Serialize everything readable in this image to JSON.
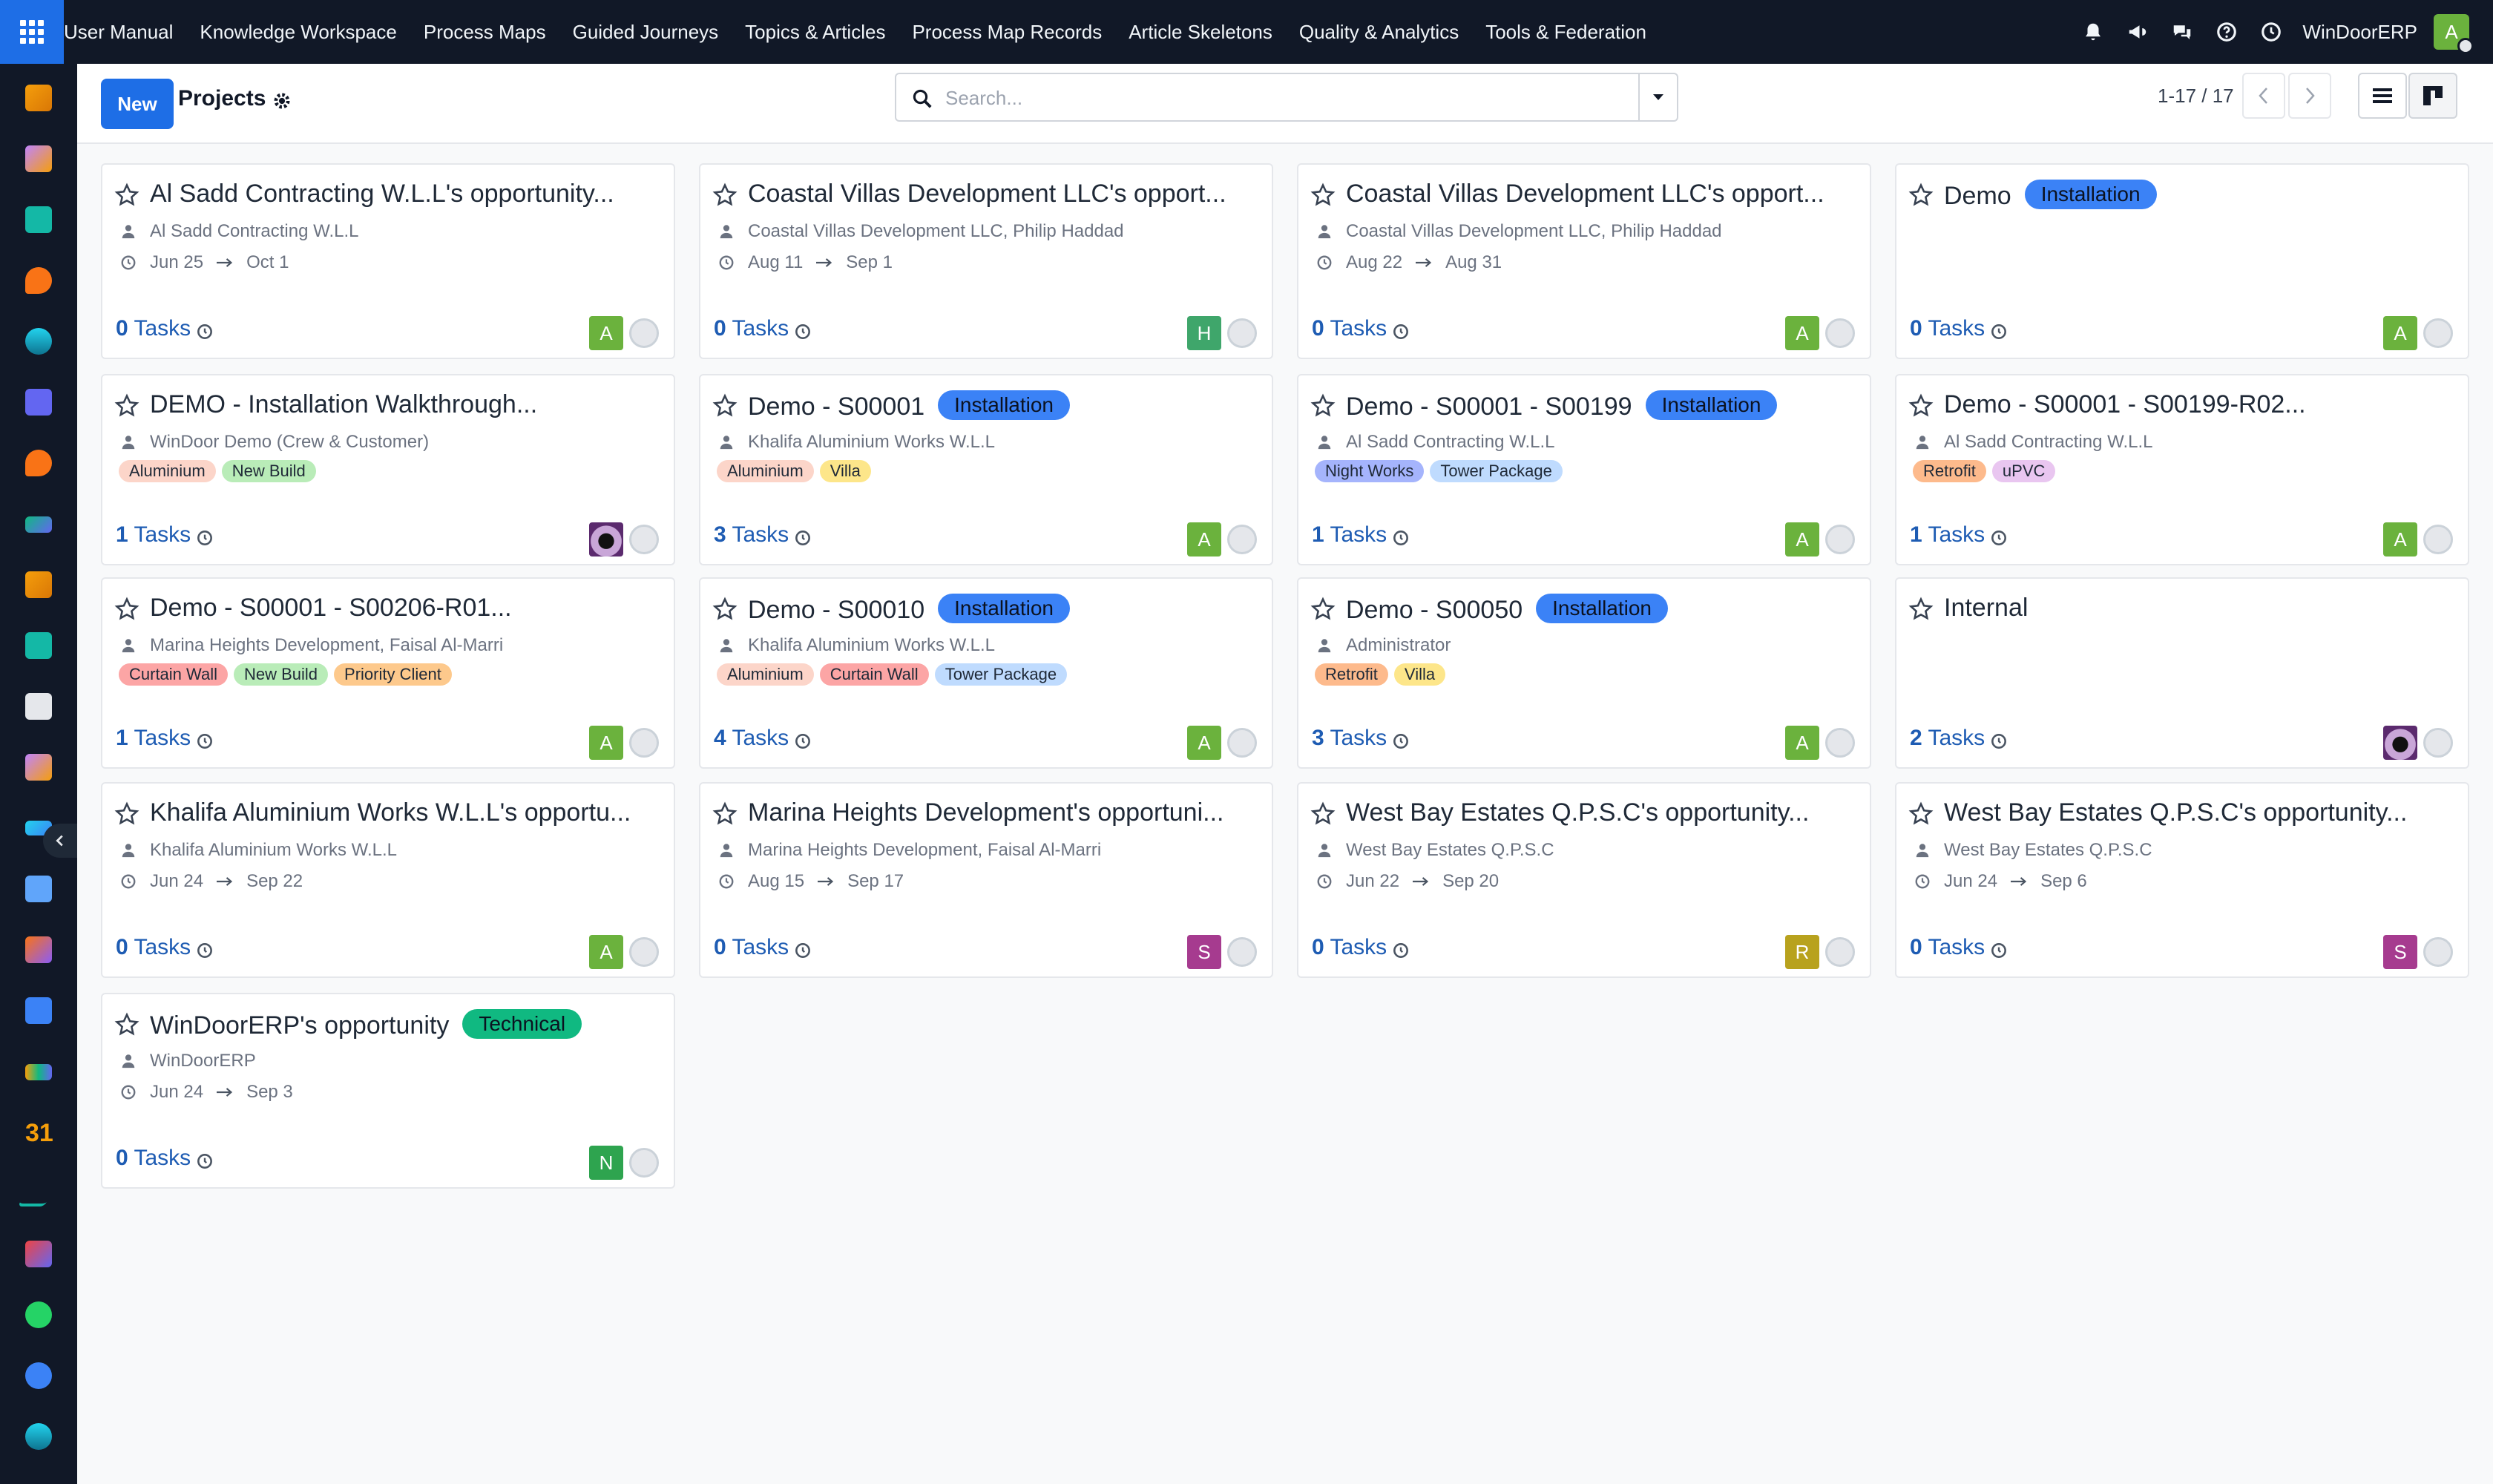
{
  "topbar": {
    "menu": [
      "User Manual",
      "Knowledge Workspace",
      "Process Maps",
      "Guided Journeys",
      "Topics & Articles",
      "Process Map Records",
      "Article Skeletons",
      "Quality & Analytics",
      "Tools & Federation"
    ],
    "company": "WinDoorERP",
    "user_initial": "A",
    "icons": [
      "bell-icon",
      "megaphone-icon",
      "chat-icon",
      "help-icon",
      "clock-icon"
    ]
  },
  "sidebar": {
    "icons": [
      "sales-app-icon",
      "crm-app-icon",
      "contacts-app-icon",
      "discuss-app-icon",
      "knowledge-app-icon",
      "mail-app-icon",
      "livechat-app-icon",
      "project-app-icon",
      "reports-app-icon",
      "employees-app-icon",
      "inventory-app-icon",
      "quality-app-icon",
      "todo-app-icon",
      "documents-app-icon",
      "packages-app-icon",
      "accounting-app-icon",
      "hr-app-icon",
      "calendar-app-icon",
      "sign-app-icon",
      "dashboards-app-icon",
      "whatsapp-app-icon",
      "timesheet-app-icon",
      "discuss2-app-icon"
    ],
    "calendar_label": "31"
  },
  "control": {
    "new_label": "New",
    "title": "Projects",
    "search_placeholder": "Search...",
    "pager": "1-17 / 17"
  },
  "colors": {
    "accent": "#1e6ee6",
    "navbar": "#111827",
    "status_installation": "#3b82f6",
    "status_technical": "#10b981"
  },
  "cards": [
    {
      "title": "Al Sadd Contracting W.L.L's opportunity...",
      "status": "",
      "customer": "Al Sadd Contracting W.L.L",
      "date_start": "Jun 25",
      "date_end": "Oct 1",
      "tags": [],
      "task_count": "0",
      "task_word": "Tasks",
      "avatar": "A"
    },
    {
      "title": "Coastal Villas Development LLC's opport...",
      "status": "",
      "customer": "Coastal Villas Development LLC, Philip Haddad",
      "date_start": "Aug 11",
      "date_end": "Sep 1",
      "tags": [],
      "task_count": "0",
      "task_word": "Tasks",
      "avatar": "H"
    },
    {
      "title": "Coastal Villas Development LLC's opport...",
      "status": "",
      "customer": "Coastal Villas Development LLC, Philip Haddad",
      "date_start": "Aug 22",
      "date_end": "Aug 31",
      "tags": [],
      "task_count": "0",
      "task_word": "Tasks",
      "avatar": "A"
    },
    {
      "title": "Demo",
      "status": "Installation",
      "customer": "",
      "date_start": "",
      "date_end": "",
      "tags": [],
      "task_count": "0",
      "task_word": "Tasks",
      "avatar": "A"
    },
    {
      "title": "DEMO - Installation Walkthrough...",
      "status": "",
      "customer": "WinDoor Demo (Crew & Customer)",
      "date_start": "",
      "date_end": "",
      "tags": [
        "Aluminium",
        "New Build"
      ],
      "task_count": "1",
      "task_word": "Tasks",
      "avatar": "img"
    },
    {
      "title": "Demo - S00001",
      "status": "Installation",
      "customer": "Khalifa Aluminium Works W.L.L",
      "date_start": "",
      "date_end": "",
      "tags": [
        "Aluminium",
        "Villa"
      ],
      "task_count": "3",
      "task_word": "Tasks",
      "avatar": "A"
    },
    {
      "title": "Demo - S00001 - S00199",
      "status": "Installation",
      "customer": "Al Sadd Contracting W.L.L",
      "date_start": "",
      "date_end": "",
      "tags": [
        "Night Works",
        "Tower Package"
      ],
      "task_count": "1",
      "task_word": "Tasks",
      "avatar": "A"
    },
    {
      "title": "Demo - S00001 - S00199-R02...",
      "status": "",
      "customer": "Al Sadd Contracting W.L.L",
      "date_start": "",
      "date_end": "",
      "tags": [
        "Retrofit",
        "uPVC"
      ],
      "task_count": "1",
      "task_word": "Tasks",
      "avatar": "A"
    },
    {
      "title": "Demo - S00001 - S00206-R01...",
      "status": "",
      "customer": "Marina Heights Development, Faisal Al-Marri",
      "date_start": "",
      "date_end": "",
      "tags": [
        "Curtain Wall",
        "New Build",
        "Priority Client"
      ],
      "task_count": "1",
      "task_word": "Tasks",
      "avatar": "A"
    },
    {
      "title": "Demo - S00010",
      "status": "Installation",
      "customer": "Khalifa Aluminium Works W.L.L",
      "date_start": "",
      "date_end": "",
      "tags": [
        "Aluminium",
        "Curtain Wall",
        "Tower Package"
      ],
      "task_count": "4",
      "task_word": "Tasks",
      "avatar": "A"
    },
    {
      "title": "Demo - S00050",
      "status": "Installation",
      "customer": "Administrator",
      "date_start": "",
      "date_end": "",
      "tags": [
        "Retrofit",
        "Villa"
      ],
      "task_count": "3",
      "task_word": "Tasks",
      "avatar": "A"
    },
    {
      "title": "Internal",
      "status": "",
      "customer": "",
      "date_start": "",
      "date_end": "",
      "tags": [],
      "task_count": "2",
      "task_word": "Tasks",
      "avatar": "img"
    },
    {
      "title": "Khalifa Aluminium Works W.L.L's opportu...",
      "status": "",
      "customer": "Khalifa Aluminium Works W.L.L",
      "date_start": "Jun 24",
      "date_end": "Sep 22",
      "tags": [],
      "task_count": "0",
      "task_word": "Tasks",
      "avatar": "A"
    },
    {
      "title": "Marina Heights Development's opportuni...",
      "status": "",
      "customer": "Marina Heights Development, Faisal Al-Marri",
      "date_start": "Aug 15",
      "date_end": "Sep 17",
      "tags": [],
      "task_count": "0",
      "task_word": "Tasks",
      "avatar": "S"
    },
    {
      "title": "West Bay Estates Q.P.S.C's opportunity...",
      "status": "",
      "customer": "West Bay Estates Q.P.S.C",
      "date_start": "Jun 22",
      "date_end": "Sep 20",
      "tags": [],
      "task_count": "0",
      "task_word": "Tasks",
      "avatar": "R"
    },
    {
      "title": "West Bay Estates Q.P.S.C's opportunity...",
      "status": "",
      "customer": "West Bay Estates Q.P.S.C",
      "date_start": "Jun 24",
      "date_end": "Sep 6",
      "tags": [],
      "task_count": "0",
      "task_word": "Tasks",
      "avatar": "S"
    },
    {
      "title": "WinDoorERP's opportunity",
      "status": "Technical",
      "customer": "WinDoorERP",
      "date_start": "Jun 24",
      "date_end": "Sep 3",
      "tags": [],
      "task_count": "0",
      "task_word": "Tasks",
      "avatar": "N"
    }
  ],
  "tag_colors": {
    "Aluminium": "#fcd5c9",
    "New Build": "#b9ecb8",
    "Villa": "#fde68a",
    "Night Works": "#a5b4fc",
    "Tower Package": "#bfdbfe",
    "Retrofit": "#fdba8c",
    "uPVC": "#e9c6f0",
    "Curtain Wall": "#fca5a5",
    "Priority Client": "#fdc98c"
  },
  "avatar_colors": {
    "A": "#6bb23d",
    "H": "#3fa66b",
    "S": "#a63b8f",
    "R": "#b8a21e",
    "N": "#2ea44f"
  }
}
